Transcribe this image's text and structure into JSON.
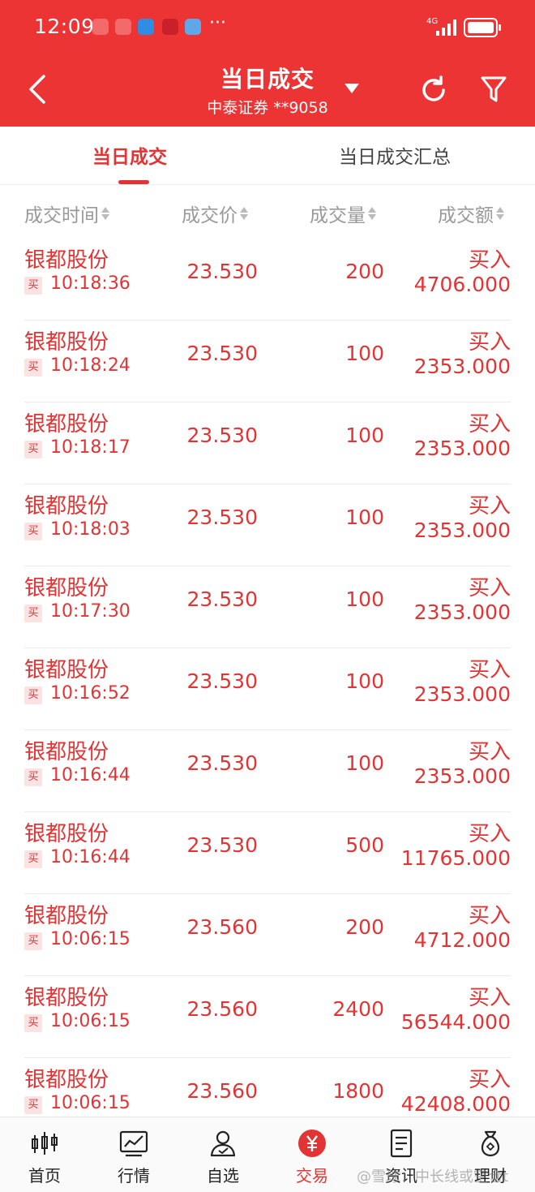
{
  "status_bar": {
    "time": "12:09",
    "more": "···",
    "network": "4G"
  },
  "header": {
    "title": "当日成交",
    "subtitle": "中泰证券 **9058"
  },
  "tabs": [
    {
      "label": "当日成交",
      "active": true
    },
    {
      "label": "当日成交汇总",
      "active": false
    }
  ],
  "columns": [
    "成交时间",
    "成交价",
    "成交量",
    "成交额"
  ],
  "rows": [
    {
      "name": "银都股份",
      "badge": "买",
      "time": "10:18:36",
      "price": "23.530",
      "qty": "200",
      "side": "买入",
      "amount": "4706.000"
    },
    {
      "name": "银都股份",
      "badge": "买",
      "time": "10:18:24",
      "price": "23.530",
      "qty": "100",
      "side": "买入",
      "amount": "2353.000"
    },
    {
      "name": "银都股份",
      "badge": "买",
      "time": "10:18:17",
      "price": "23.530",
      "qty": "100",
      "side": "买入",
      "amount": "2353.000"
    },
    {
      "name": "银都股份",
      "badge": "买",
      "time": "10:18:03",
      "price": "23.530",
      "qty": "100",
      "side": "买入",
      "amount": "2353.000"
    },
    {
      "name": "银都股份",
      "badge": "买",
      "time": "10:17:30",
      "price": "23.530",
      "qty": "100",
      "side": "买入",
      "amount": "2353.000"
    },
    {
      "name": "银都股份",
      "badge": "买",
      "time": "10:16:52",
      "price": "23.530",
      "qty": "100",
      "side": "买入",
      "amount": "2353.000"
    },
    {
      "name": "银都股份",
      "badge": "买",
      "time": "10:16:44",
      "price": "23.530",
      "qty": "100",
      "side": "买入",
      "amount": "2353.000"
    },
    {
      "name": "银都股份",
      "badge": "买",
      "time": "10:16:44",
      "price": "23.530",
      "qty": "500",
      "side": "买入",
      "amount": "11765.000"
    },
    {
      "name": "银都股份",
      "badge": "买",
      "time": "10:06:15",
      "price": "23.560",
      "qty": "200",
      "side": "买入",
      "amount": "4712.000"
    },
    {
      "name": "银都股份",
      "badge": "买",
      "time": "10:06:15",
      "price": "23.560",
      "qty": "2400",
      "side": "买入",
      "amount": "56544.000"
    },
    {
      "name": "银都股份",
      "badge": "买",
      "time": "10:06:15",
      "price": "23.560",
      "qty": "1800",
      "side": "买入",
      "amount": "42408.000"
    }
  ],
  "bottom_nav": [
    {
      "label": "首页",
      "icon": "candlestick-icon",
      "active": false
    },
    {
      "label": "行情",
      "icon": "chart-icon",
      "active": false
    },
    {
      "label": "自选",
      "icon": "user-icon",
      "active": false
    },
    {
      "label": "交易",
      "icon": "yen-icon",
      "active": true
    },
    {
      "label": "资讯",
      "icon": "document-icon",
      "active": false
    },
    {
      "label": "理财",
      "icon": "money-bag-icon",
      "active": false
    }
  ],
  "watermark": "@雪球：中长线或空仓t",
  "colors": {
    "brand_red": "#ec3434",
    "text_red": "#e23434",
    "gray": "#999999"
  }
}
